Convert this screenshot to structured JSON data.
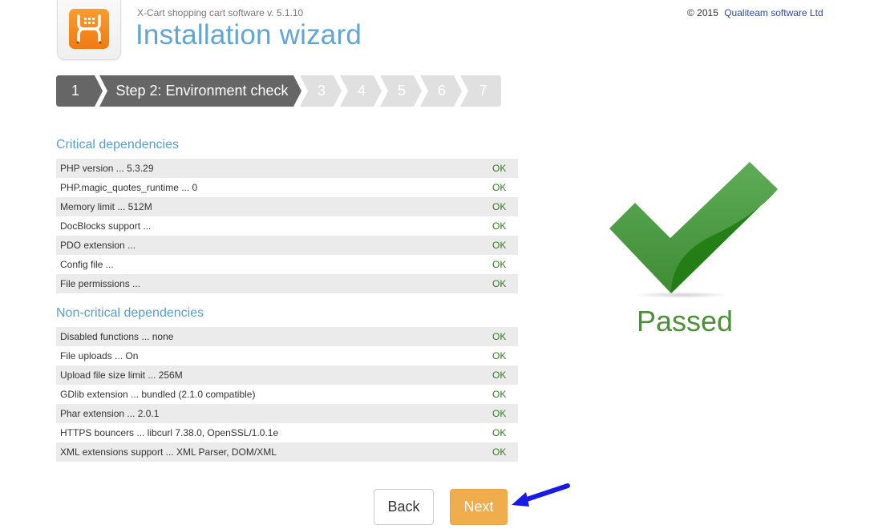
{
  "header": {
    "subtitle": "X-Cart shopping cart software v. 5.1.10",
    "title": "Installation wizard",
    "copyright": "© 2015",
    "company_link": "Qualiteam software Ltd",
    "logo_icon": "x-cart-logo-icon"
  },
  "steps": [
    {
      "label": "1",
      "state": "done"
    },
    {
      "label": "Step 2: Environment check",
      "state": "current"
    },
    {
      "label": "3",
      "state": "pending"
    },
    {
      "label": "4",
      "state": "pending"
    },
    {
      "label": "5",
      "state": "pending"
    },
    {
      "label": "6",
      "state": "pending"
    },
    {
      "label": "7",
      "state": "pending"
    }
  ],
  "critical": {
    "title": "Critical dependencies",
    "rows": [
      {
        "label": "PHP version ... 5.3.29",
        "status": "OK"
      },
      {
        "label": "PHP.magic_quotes_runtime ... 0",
        "status": "OK"
      },
      {
        "label": "Memory limit ... 512M",
        "status": "OK"
      },
      {
        "label": "DocBlocks support ...",
        "status": "OK"
      },
      {
        "label": "PDO extension ...",
        "status": "OK"
      },
      {
        "label": "Config file ...",
        "status": "OK"
      },
      {
        "label": "File permissions ...",
        "status": "OK"
      }
    ]
  },
  "noncritical": {
    "title": "Non-critical dependencies",
    "rows": [
      {
        "label": "Disabled functions ... none",
        "status": "OK"
      },
      {
        "label": "File uploads ... On",
        "status": "OK"
      },
      {
        "label": "Upload file size limit ... 256M",
        "status": "OK"
      },
      {
        "label": "GDlib extension ... bundled (2.1.0 compatible)",
        "status": "OK"
      },
      {
        "label": "Phar extension ... 2.0.1",
        "status": "OK"
      },
      {
        "label": "HTTPS bouncers ... libcurl 7.38.0, OpenSSL/1.0.1e",
        "status": "OK"
      },
      {
        "label": "XML extensions support ... XML Parser, DOM/XML",
        "status": "OK"
      }
    ]
  },
  "result": {
    "icon": "checkmark-icon",
    "label": "Passed"
  },
  "buttons": {
    "back": "Back",
    "next": "Next"
  },
  "colors": {
    "accent": "#62a5d2",
    "step_active": "#666666",
    "step_pending": "#e0e0e0",
    "ok": "#2e7d1e",
    "next_button": "#f0ad4e",
    "passed": "#4e8f3a",
    "annotation_arrow": "#1a1ae6"
  }
}
